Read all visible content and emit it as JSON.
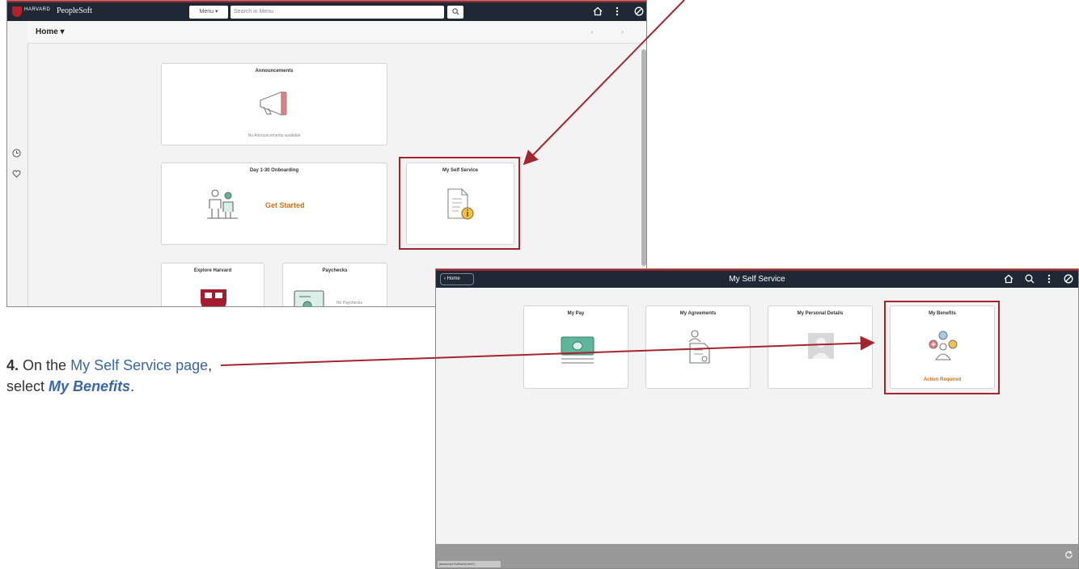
{
  "screen1": {
    "brand": {
      "university": "HARVARD",
      "product": "PeopleSoft"
    },
    "menu_label": "Menu ▾",
    "search_placeholder": "Search in Menu",
    "home_label": "Home ▾",
    "nav_arrows": "‹ ›",
    "tiles": {
      "announcements": {
        "title": "Announcements",
        "subtitle": "No Announcements available"
      },
      "onboarding": {
        "title": "Day 1-30 Onboarding",
        "cta": "Get Started"
      },
      "self_service": {
        "title": "My Self Service"
      },
      "explore": {
        "title": "Explore Harvard"
      },
      "paychecks": {
        "title": "Paychecks",
        "subtitle": "No Paychecks"
      }
    }
  },
  "screen2": {
    "back_label": "‹ Home",
    "page_title": "My Self Service",
    "tiles": {
      "pay": {
        "title": "My Pay"
      },
      "agreements": {
        "title": "My Agreements"
      },
      "personal": {
        "title": "My Personal Details"
      },
      "benefits": {
        "title": "My Benefits",
        "status": "Action Required"
      }
    },
    "status_text": "javascript:DoBack('win0')"
  },
  "instruction": {
    "step": "4.",
    "prefix": "On the",
    "page_name": "My Self Service page",
    "middle": ", select",
    "target": "My Benefits",
    "suffix": "."
  },
  "colors": {
    "header_bg": "#1f2935",
    "brand_red": "#b3202a",
    "annotation_red": "#a32530",
    "instruction_blue": "#3a66a8",
    "cta_orange": "#c8741a"
  }
}
